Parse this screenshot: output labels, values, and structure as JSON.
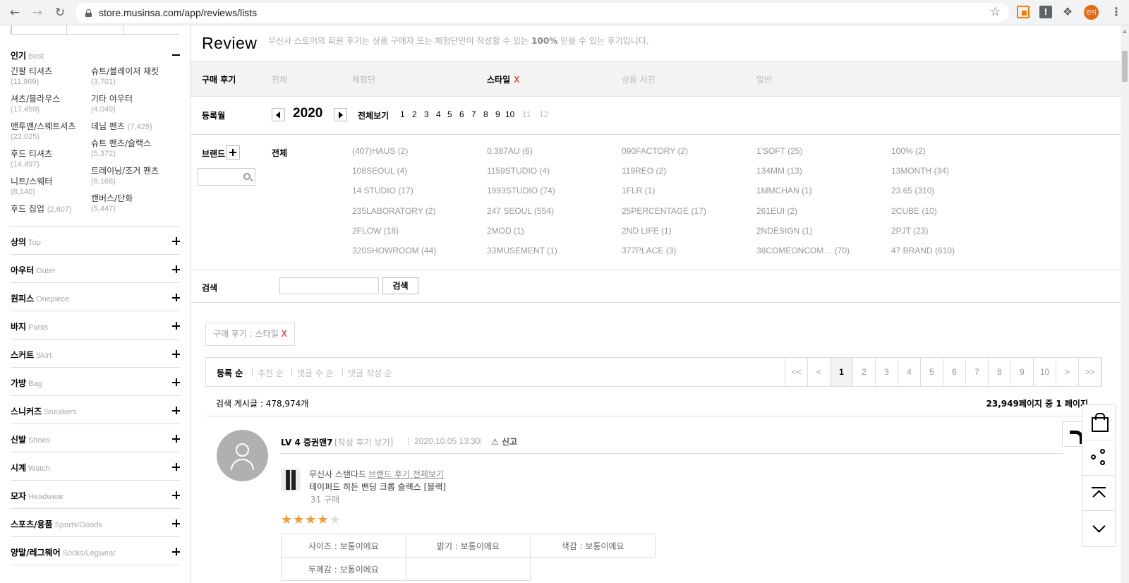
{
  "browser": {
    "url": "store.musinsa.com/app/reviews/lists",
    "profile": "민지"
  },
  "sidebar": {
    "best": {
      "kr": "인기",
      "en": "Best"
    },
    "best_items": [
      {
        "name": "긴팔 티셔츠",
        "count": "(11,969)"
      },
      {
        "name": "슈트/블레이저 재킷",
        "count": "(3,701)"
      },
      {
        "name": "셔츠/블라우스",
        "count": "(17,459)"
      },
      {
        "name": "기타 아우터",
        "count": "(4,049)"
      },
      {
        "name": "맨투맨/스웨트셔츠",
        "count": "(22,025)"
      },
      {
        "name": "데님 팬츠",
        "count": "(7,429)"
      },
      {
        "name": "후드 티셔츠",
        "count": "(14,497)"
      },
      {
        "name": "슈트 팬츠/슬랙스",
        "count": "(5,372)"
      },
      {
        "name": "니트/스웨터",
        "count": "(8,140)"
      },
      {
        "name": "트레이닝/조거 팬츠",
        "count": "(8,168)"
      },
      {
        "name": "후드 집업",
        "count": "(2,607)"
      },
      {
        "name": "캔버스/단화",
        "count": "(5,447)"
      }
    ],
    "categories": [
      {
        "kr": "상의",
        "en": "Top"
      },
      {
        "kr": "아우터",
        "en": "Outer"
      },
      {
        "kr": "원피스",
        "en": "Onepiece"
      },
      {
        "kr": "바지",
        "en": "Pants"
      },
      {
        "kr": "스커트",
        "en": "Skirt"
      },
      {
        "kr": "가방",
        "en": "Bag"
      },
      {
        "kr": "스니커즈",
        "en": "Sneakers"
      },
      {
        "kr": "신발",
        "en": "Shoes"
      },
      {
        "kr": "시계",
        "en": "Watch"
      },
      {
        "kr": "모자",
        "en": "Headwear"
      },
      {
        "kr": "스포츠/용품",
        "en": "Sports/Goods"
      },
      {
        "kr": "양말/레그웨어",
        "en": "Socks/Legwear"
      }
    ]
  },
  "header": {
    "title": "Review",
    "desc_pre": "무신사 스토어의 회원 후기는 상품 구매자 또는 체험단만이 작성할 수 있는 ",
    "desc_bold": "100%",
    "desc_post": " 믿을 수 있는 후기입니다."
  },
  "type_filter": {
    "label": "구매 후기",
    "options": [
      "전체",
      "체험단",
      "스타일",
      "상품 사진",
      "일반"
    ],
    "active": "스타일",
    "remove": "X"
  },
  "month_filter": {
    "label": "등록월",
    "year": "2020",
    "all_label": "전체보기",
    "months": [
      "1",
      "2",
      "3",
      "4",
      "5",
      "6",
      "7",
      "8",
      "9",
      "10",
      "11",
      "12"
    ]
  },
  "brand_filter": {
    "label": "브랜드",
    "all_label": "전체",
    "brands": [
      "(407)HAUS (2)",
      "0,387AU (6)",
      "090FACTORY (2)",
      "1'SOFT (25)",
      "100% (2)",
      "108SEOUL (4)",
      "1159STUDIO (4)",
      "119REO (2)",
      "134MM (13)",
      "13MONTH (34)",
      "14 STUDIO (17)",
      "1993STUDIO (74)",
      "1FLR (1)",
      "1MMCHAN (1)",
      "23.65 (310)",
      "235LABORATORY (2)",
      "247 SEOUL (554)",
      "25PERCENTAGE (17)",
      "261EUI (2)",
      "2CUBE (10)",
      "2FLOW (18)",
      "2MOD (1)",
      "2ND LIFE (1)",
      "2NDESIGN (1)",
      "2PJT (23)",
      "320SHOWROOM (44)",
      "33MUSEMENT (1)",
      "377PLACE (3)",
      "38COMEONCOM… (70)",
      "47 BRAND (610)"
    ]
  },
  "search": {
    "label": "검색",
    "button": "검색",
    "value": ""
  },
  "active_filter_tag": {
    "text": "구매 후기 : 스타일",
    "remove": "X"
  },
  "sort_options": [
    "등록 순",
    "추천 순",
    "댓글 수 순",
    "댓글 작성 순"
  ],
  "pagination": [
    "<<",
    "<",
    "1",
    "2",
    "3",
    "4",
    "5",
    "6",
    "7",
    "8",
    "9",
    "10",
    ">",
    ">>"
  ],
  "summary": {
    "count_label": "검색 게시글 : 478,974개",
    "page_label": "23,949페이지 중 1 페이지"
  },
  "review": {
    "user": "LV 4 증권맨7",
    "history_link": "[작성 후기 보기]",
    "date": "2020.10.05 13:30",
    "report": "신고",
    "brand": "무신사 스탠다드",
    "brand_link": "브랜드 후기 전체보기",
    "product": "테이퍼드 히든 밴딩 크롭 슬랙스 [블랙]",
    "size": "31 구매",
    "rating": 4,
    "rating_max": 5,
    "eval": [
      "사이즈 : 보통이에요",
      "밝기 : 보통이에요",
      "색감 : 보통이에요",
      "두께감 : 보통이에요"
    ]
  }
}
